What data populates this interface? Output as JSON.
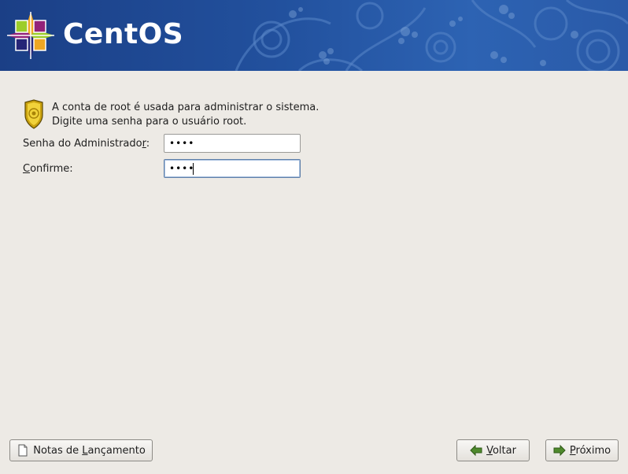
{
  "header": {
    "brand": "CentOS"
  },
  "info": {
    "line1": "A conta de root é usada para administrar o sistema.",
    "line2": "Digite uma senha para o usuário root."
  },
  "form": {
    "admin_password_label_pre": "Senha do Administrado",
    "admin_password_label_mnemonic": "r",
    "admin_password_label_post": ":",
    "admin_password_value": "••••",
    "confirm_label_mnemonic": "C",
    "confirm_label_post": "onfirme:",
    "confirm_value": "••••"
  },
  "footer": {
    "release_notes_pre": "Notas de ",
    "release_notes_mnemonic": "L",
    "release_notes_post": "ançamento",
    "back_mnemonic": "V",
    "back_post": "oltar",
    "next_mnemonic": "P",
    "next_post": "róximo"
  },
  "colors": {
    "banner": "#22519e",
    "background": "#edeae5"
  },
  "icons": {
    "logo": "centos-logo-icon",
    "shield": "shield-icon",
    "notes": "document-icon",
    "back": "arrow-left-icon",
    "next": "arrow-right-icon"
  }
}
